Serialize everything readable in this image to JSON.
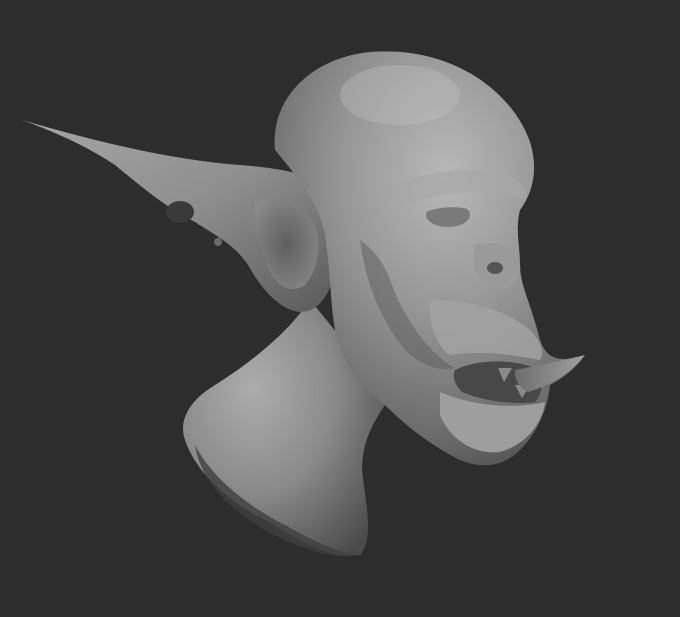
{
  "viewport": {
    "background_color": "#2d2d2d",
    "model_color": "#8c8c8c",
    "highlight_color": "#b4b4b4",
    "shadow_color": "#3c3c3c"
  },
  "model": {
    "subject": "goblin-head-sculpt",
    "parts": [
      "head",
      "ear",
      "neck",
      "eye",
      "nose",
      "mouth",
      "tusk"
    ]
  }
}
